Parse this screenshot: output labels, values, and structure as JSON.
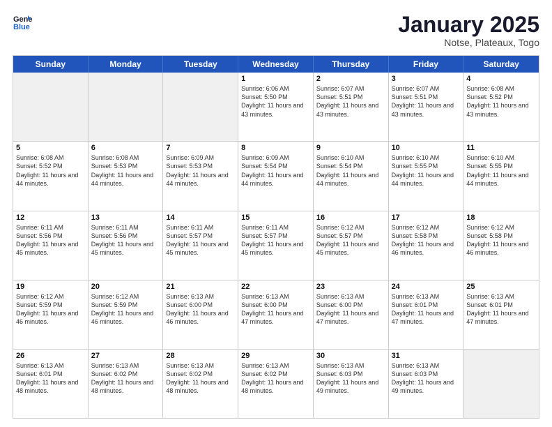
{
  "header": {
    "logo_line1": "General",
    "logo_line2": "Blue",
    "title": "January 2025",
    "subtitle": "Notse, Plateaux, Togo"
  },
  "weekdays": [
    "Sunday",
    "Monday",
    "Tuesday",
    "Wednesday",
    "Thursday",
    "Friday",
    "Saturday"
  ],
  "rows": [
    [
      {
        "day": "",
        "info": "",
        "shaded": true
      },
      {
        "day": "",
        "info": "",
        "shaded": true
      },
      {
        "day": "",
        "info": "",
        "shaded": true
      },
      {
        "day": "1",
        "info": "Sunrise: 6:06 AM\nSunset: 5:50 PM\nDaylight: 11 hours\nand 43 minutes."
      },
      {
        "day": "2",
        "info": "Sunrise: 6:07 AM\nSunset: 5:51 PM\nDaylight: 11 hours\nand 43 minutes."
      },
      {
        "day": "3",
        "info": "Sunrise: 6:07 AM\nSunset: 5:51 PM\nDaylight: 11 hours\nand 43 minutes."
      },
      {
        "day": "4",
        "info": "Sunrise: 6:08 AM\nSunset: 5:52 PM\nDaylight: 11 hours\nand 43 minutes."
      }
    ],
    [
      {
        "day": "5",
        "info": "Sunrise: 6:08 AM\nSunset: 5:52 PM\nDaylight: 11 hours\nand 44 minutes."
      },
      {
        "day": "6",
        "info": "Sunrise: 6:08 AM\nSunset: 5:53 PM\nDaylight: 11 hours\nand 44 minutes."
      },
      {
        "day": "7",
        "info": "Sunrise: 6:09 AM\nSunset: 5:53 PM\nDaylight: 11 hours\nand 44 minutes."
      },
      {
        "day": "8",
        "info": "Sunrise: 6:09 AM\nSunset: 5:54 PM\nDaylight: 11 hours\nand 44 minutes."
      },
      {
        "day": "9",
        "info": "Sunrise: 6:10 AM\nSunset: 5:54 PM\nDaylight: 11 hours\nand 44 minutes."
      },
      {
        "day": "10",
        "info": "Sunrise: 6:10 AM\nSunset: 5:55 PM\nDaylight: 11 hours\nand 44 minutes."
      },
      {
        "day": "11",
        "info": "Sunrise: 6:10 AM\nSunset: 5:55 PM\nDaylight: 11 hours\nand 44 minutes."
      }
    ],
    [
      {
        "day": "12",
        "info": "Sunrise: 6:11 AM\nSunset: 5:56 PM\nDaylight: 11 hours\nand 45 minutes."
      },
      {
        "day": "13",
        "info": "Sunrise: 6:11 AM\nSunset: 5:56 PM\nDaylight: 11 hours\nand 45 minutes."
      },
      {
        "day": "14",
        "info": "Sunrise: 6:11 AM\nSunset: 5:57 PM\nDaylight: 11 hours\nand 45 minutes."
      },
      {
        "day": "15",
        "info": "Sunrise: 6:11 AM\nSunset: 5:57 PM\nDaylight: 11 hours\nand 45 minutes."
      },
      {
        "day": "16",
        "info": "Sunrise: 6:12 AM\nSunset: 5:57 PM\nDaylight: 11 hours\nand 45 minutes."
      },
      {
        "day": "17",
        "info": "Sunrise: 6:12 AM\nSunset: 5:58 PM\nDaylight: 11 hours\nand 46 minutes."
      },
      {
        "day": "18",
        "info": "Sunrise: 6:12 AM\nSunset: 5:58 PM\nDaylight: 11 hours\nand 46 minutes."
      }
    ],
    [
      {
        "day": "19",
        "info": "Sunrise: 6:12 AM\nSunset: 5:59 PM\nDaylight: 11 hours\nand 46 minutes."
      },
      {
        "day": "20",
        "info": "Sunrise: 6:12 AM\nSunset: 5:59 PM\nDaylight: 11 hours\nand 46 minutes."
      },
      {
        "day": "21",
        "info": "Sunrise: 6:13 AM\nSunset: 6:00 PM\nDaylight: 11 hours\nand 46 minutes."
      },
      {
        "day": "22",
        "info": "Sunrise: 6:13 AM\nSunset: 6:00 PM\nDaylight: 11 hours\nand 47 minutes."
      },
      {
        "day": "23",
        "info": "Sunrise: 6:13 AM\nSunset: 6:00 PM\nDaylight: 11 hours\nand 47 minutes."
      },
      {
        "day": "24",
        "info": "Sunrise: 6:13 AM\nSunset: 6:01 PM\nDaylight: 11 hours\nand 47 minutes."
      },
      {
        "day": "25",
        "info": "Sunrise: 6:13 AM\nSunset: 6:01 PM\nDaylight: 11 hours\nand 47 minutes."
      }
    ],
    [
      {
        "day": "26",
        "info": "Sunrise: 6:13 AM\nSunset: 6:01 PM\nDaylight: 11 hours\nand 48 minutes."
      },
      {
        "day": "27",
        "info": "Sunrise: 6:13 AM\nSunset: 6:02 PM\nDaylight: 11 hours\nand 48 minutes."
      },
      {
        "day": "28",
        "info": "Sunrise: 6:13 AM\nSunset: 6:02 PM\nDaylight: 11 hours\nand 48 minutes."
      },
      {
        "day": "29",
        "info": "Sunrise: 6:13 AM\nSunset: 6:02 PM\nDaylight: 11 hours\nand 48 minutes."
      },
      {
        "day": "30",
        "info": "Sunrise: 6:13 AM\nSunset: 6:03 PM\nDaylight: 11 hours\nand 49 minutes."
      },
      {
        "day": "31",
        "info": "Sunrise: 6:13 AM\nSunset: 6:03 PM\nDaylight: 11 hours\nand 49 minutes."
      },
      {
        "day": "",
        "info": "",
        "shaded": true
      }
    ]
  ]
}
